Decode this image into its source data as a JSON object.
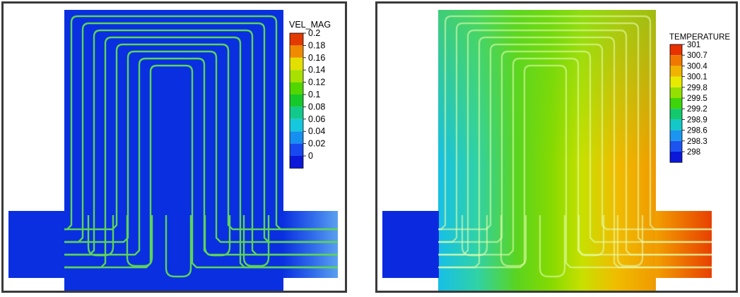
{
  "panels": [
    {
      "id": "velocity",
      "legend": {
        "title": "VEL_MAG",
        "ticks": [
          "0.2",
          "0.18",
          "0.16",
          "0.14",
          "0.12",
          "0.1",
          "0.08",
          "0.06",
          "0.04",
          "0.02",
          "0"
        ],
        "colors": [
          "#e33a00",
          "#f08a00",
          "#e3df00",
          "#a8e000",
          "#52d600",
          "#15c92a",
          "#12c98c",
          "#16c8de",
          "#1690f0",
          "#1848f0",
          "#0b18d8"
        ]
      },
      "field": {
        "background": "#0a2fe0",
        "channel_color": "#5cd35a",
        "outlet_color": "#2b62ea"
      }
    },
    {
      "id": "temperature",
      "legend": {
        "title": "TEMPERATURE",
        "ticks": [
          "301",
          "300.7",
          "300.4",
          "300.1",
          "299.8",
          "299.5",
          "299.2",
          "298.9",
          "298.6",
          "298.3",
          "298"
        ],
        "colors": [
          "#e83200",
          "#f07800",
          "#f0b400",
          "#e8ea00",
          "#94e000",
          "#3ed40a",
          "#12c96e",
          "#14c8c8",
          "#1a96f0",
          "#1c54f0",
          "#0b18d8"
        ]
      },
      "field": {
        "inlet_color": "#0b2ae0",
        "outlet_color": "#f05a00",
        "gradient": [
          "#18c6e4",
          "#3ad494",
          "#6ad61c",
          "#9ae000",
          "#e0e000",
          "#f2b400",
          "#f09000"
        ]
      }
    }
  ]
}
